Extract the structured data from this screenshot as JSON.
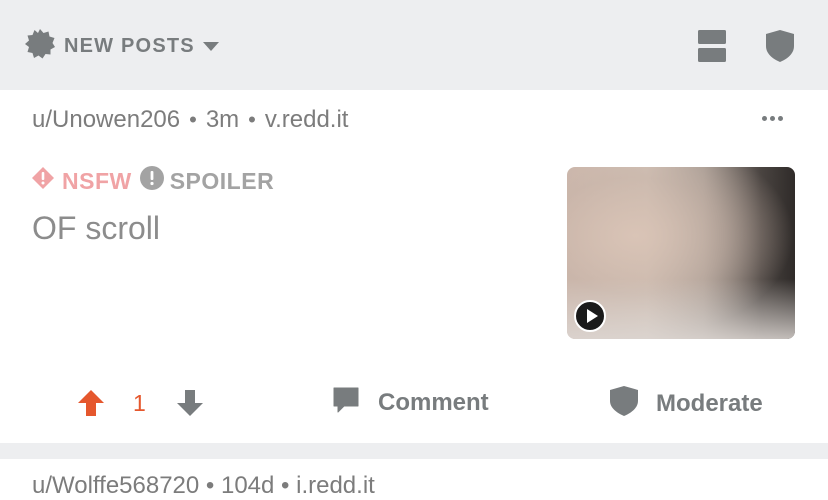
{
  "sort_bar": {
    "label": "NEW POSTS",
    "icon": "sparkle-badge-icon",
    "view_icon": "card-view-icon",
    "mod_icon": "shield-icon",
    "background": "#edeef0",
    "tab_indicator_color": "#4a90e2"
  },
  "post": {
    "author": "u/Unowen206",
    "age": "3m",
    "domain": "v.redd.it",
    "separator": "•",
    "tags": {
      "nsfw": "NSFW",
      "spoiler": "SPOILER"
    },
    "title": "OF scroll",
    "score": "1",
    "comment_label": "Comment",
    "moderate_label": "Moderate",
    "thumbnail_type": "video"
  },
  "next_post": {
    "meta": "u/Wolffe568720 • 104d • i.redd.it"
  },
  "colors": {
    "upvote": "#e5572d",
    "nsfw": "#f0a3a5",
    "muted": "#787c7e"
  }
}
